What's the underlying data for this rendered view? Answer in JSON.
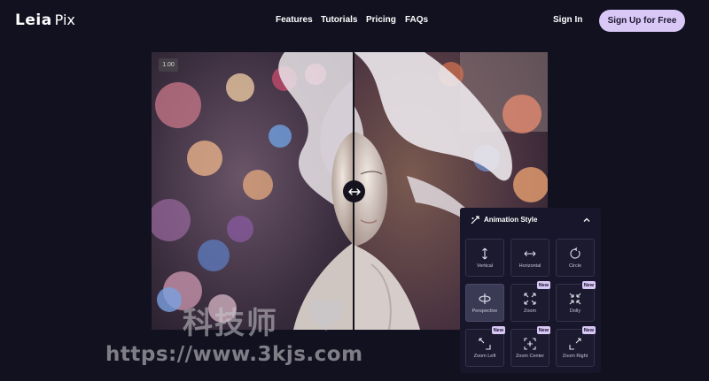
{
  "brand": {
    "logo_bold": "Leia",
    "logo_light": "Pix"
  },
  "nav": {
    "links": [
      "Features",
      "Tutorials",
      "Pricing",
      "FAQs"
    ],
    "signin_label": "Sign In",
    "signup_label": "Sign Up for Free"
  },
  "viewer": {
    "zoom_badge": "1.00"
  },
  "animation_panel": {
    "title": "Animation Style",
    "styles": [
      {
        "label": "Vertical",
        "icon": "vertical-arrows-icon",
        "is_new": false,
        "selected": false
      },
      {
        "label": "Horizontal",
        "icon": "horizontal-arrows-icon",
        "is_new": false,
        "selected": false
      },
      {
        "label": "Circle",
        "icon": "circle-arrow-icon",
        "is_new": false,
        "selected": false
      },
      {
        "label": "Perspective",
        "icon": "perspective-icon",
        "is_new": false,
        "selected": true
      },
      {
        "label": "Zoom",
        "icon": "zoom-icon",
        "is_new": true,
        "selected": false
      },
      {
        "label": "Dolly",
        "icon": "dolly-icon",
        "is_new": true,
        "selected": false
      },
      {
        "label": "Zoom Left",
        "icon": "zoom-left-icon",
        "is_new": true,
        "selected": false
      },
      {
        "label": "Zoom Center",
        "icon": "zoom-center-icon",
        "is_new": true,
        "selected": false
      },
      {
        "label": "Zoom Right",
        "icon": "zoom-right-icon",
        "is_new": true,
        "selected": false
      }
    ],
    "new_badge": "New"
  },
  "watermark": {
    "text": "科技师",
    "url": "https://www.3kjs.com"
  },
  "colors": {
    "background": "#121120",
    "accent": "#d9c8f5",
    "panel": "#17162a"
  }
}
